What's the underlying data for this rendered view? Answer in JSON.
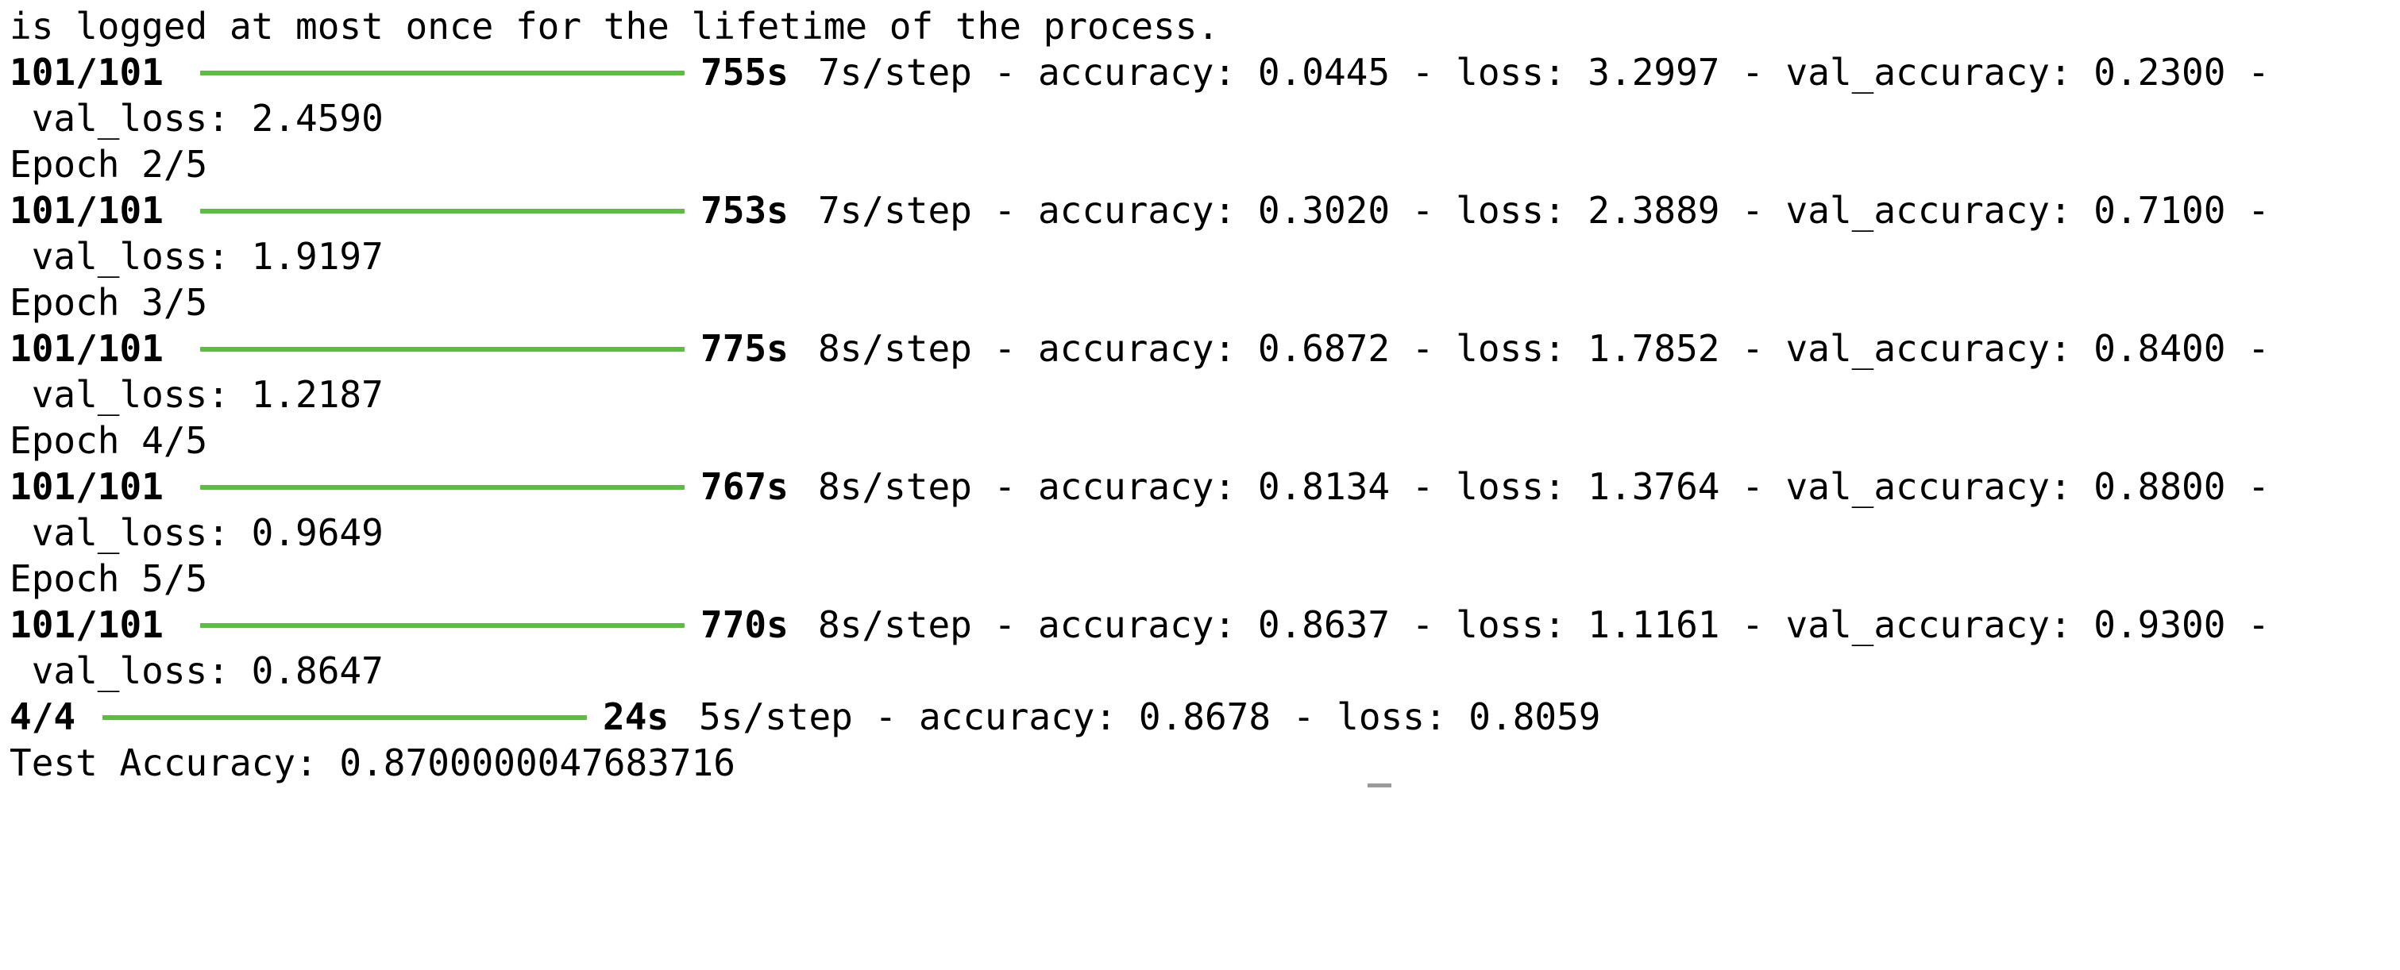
{
  "intro_line": "is logged at most once for the lifetime of the process.",
  "epochs": [
    {
      "step": "101/101",
      "time": "755s",
      "rest": "7s/step - accuracy: 0.0445 - loss: 3.2997 - val_accuracy: 0.2300 -",
      "cont": " val_loss: 2.4590",
      "progress": 1.0
    },
    {
      "header": "Epoch 2/5",
      "step": "101/101",
      "time": "753s",
      "rest": "7s/step - accuracy: 0.3020 - loss: 2.3889 - val_accuracy: 0.7100 -",
      "cont": " val_loss: 1.9197",
      "progress": 1.0
    },
    {
      "header": "Epoch 3/5",
      "step": "101/101",
      "time": "775s",
      "rest": "8s/step - accuracy: 0.6872 - loss: 1.7852 - val_accuracy: 0.8400 -",
      "cont": " val_loss: 1.2187",
      "progress": 1.0
    },
    {
      "header": "Epoch 4/5",
      "step": "101/101",
      "time": "767s",
      "rest": "8s/step - accuracy: 0.8134 - loss: 1.3764 - val_accuracy: 0.8800 -",
      "cont": " val_loss: 0.9649",
      "progress": 1.0
    },
    {
      "header": "Epoch 5/5",
      "step": "101/101",
      "time": "770s",
      "rest": "8s/step - accuracy: 0.8637 - loss: 1.1161 - val_accuracy: 0.9300 -",
      "cont": " val_loss: 0.8647",
      "progress": 1.0
    }
  ],
  "test": {
    "step": "4/4",
    "time": "24s",
    "rest": "5s/step - accuracy: 0.8678 - loss: 0.8059",
    "progress": 1.0
  },
  "result_line": "Test Accuracy: 0.8700000047683716",
  "colors": {
    "progress_bar": "#5fba46",
    "text": "#000000",
    "background": "#ffffff",
    "cursor": "#9a9a9a"
  }
}
